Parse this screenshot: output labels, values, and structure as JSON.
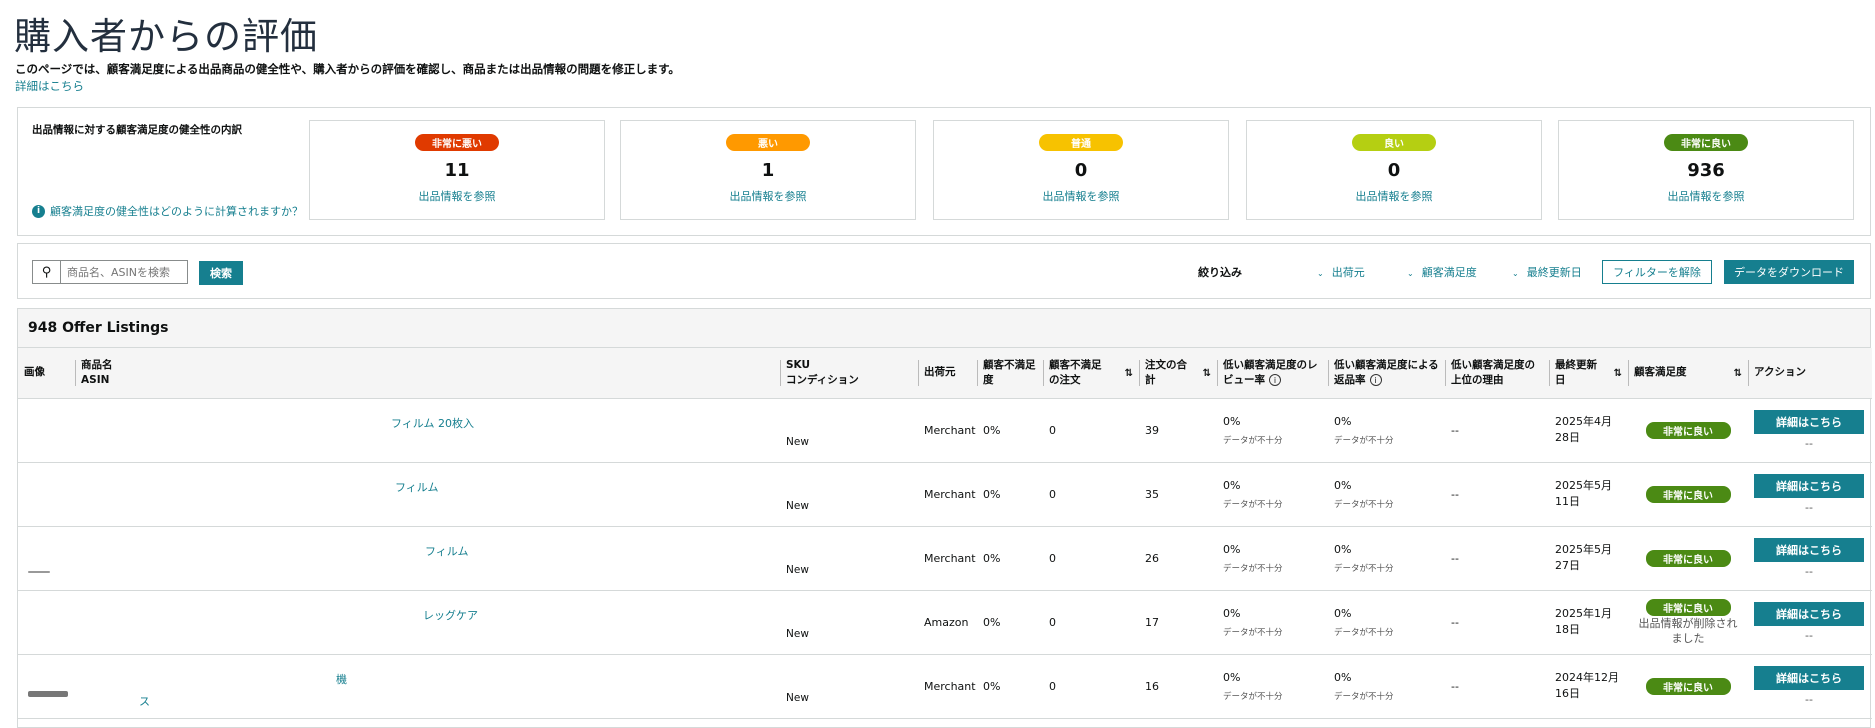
{
  "header": {
    "title": "購入者からの評価",
    "description": "このページでは、顧客満足度による出品商品の健全性や、購入者からの評価を確認し、商品または出品情報の問題を修正します。",
    "learn_more": "詳細はこちら"
  },
  "health": {
    "title": "出品情報に対する顧客満足度の健全性の内訳",
    "help_link": "顧客満足度の健全性はどのように計算されますか？",
    "cards": [
      {
        "label": "非常に悪い",
        "count": "11",
        "link": "出品情報を参照",
        "color": "#e03a00"
      },
      {
        "label": "悪い",
        "count": "1",
        "link": "出品情報を参照",
        "color": "#ff9900"
      },
      {
        "label": "普通",
        "count": "0",
        "link": "出品情報を参照",
        "color": "#f7c200"
      },
      {
        "label": "良い",
        "count": "0",
        "link": "出品情報を参照",
        "color": "#b5cf12"
      },
      {
        "label": "非常に良い",
        "count": "936",
        "link": "出品情報を参照",
        "color": "#4b8a14"
      }
    ]
  },
  "search": {
    "placeholder": "商品名、ASINを検索",
    "button": "検索"
  },
  "filters": {
    "label": "絞り込み",
    "items": [
      "出荷元",
      "顧客満足度",
      "最終更新日"
    ],
    "clear": "フィルターを解除",
    "download": "データをダウンロード"
  },
  "table": {
    "count_label": "948 Offer Listings",
    "headers": {
      "image": "画像",
      "name": "商品名",
      "asin": "ASIN",
      "sku": "SKU",
      "condition": "コンディション",
      "fulfilled": "出荷元",
      "dissat_rate": "顧客不満足度",
      "dissat_orders": "顧客不満足の注文",
      "total_orders": "注文の合計",
      "low_review": "低い顧客満足度のレビュー率",
      "low_return": "低い顧客満足度による返品率",
      "top_reason": "低い顧客満足度の上位の理由",
      "updated": "最終更新日",
      "satisfaction": "顧客満足度",
      "action": "アクション"
    },
    "rows": [
      {
        "name": "フィルム 20枚入",
        "name2": "",
        "condition": "New",
        "fulfilled": "Merchant",
        "dissat_rate": "0%",
        "dissat_orders": "0",
        "total_orders": "39",
        "review_rate": "0%",
        "review_note": "データが不十分",
        "return_rate": "0%",
        "return_note": "データが不十分",
        "reason": "--",
        "updated": "2025年4月28日",
        "satisfaction": "非常に良い",
        "note": "",
        "action": "詳細はこちら",
        "action_sub": "--"
      },
      {
        "name": "フィルム",
        "name2": "",
        "condition": "New",
        "fulfilled": "Merchant",
        "dissat_rate": "0%",
        "dissat_orders": "0",
        "total_orders": "35",
        "review_rate": "0%",
        "review_note": "データが不十分",
        "return_rate": "0%",
        "return_note": "データが不十分",
        "reason": "--",
        "updated": "2025年5月11日",
        "satisfaction": "非常に良い",
        "note": "",
        "action": "詳細はこちら",
        "action_sub": "--"
      },
      {
        "name": "フィルム",
        "name2": "",
        "condition": "New",
        "fulfilled": "Merchant",
        "dissat_rate": "0%",
        "dissat_orders": "0",
        "total_orders": "26",
        "review_rate": "0%",
        "review_note": "データが不十分",
        "return_rate": "0%",
        "return_note": "データが不十分",
        "reason": "--",
        "updated": "2025年5月27日",
        "satisfaction": "非常に良い",
        "note": "",
        "action": "詳細はこちら",
        "action_sub": "--"
      },
      {
        "name": "レッグケア",
        "name2": "",
        "condition": "New",
        "fulfilled": "Amazon",
        "dissat_rate": "0%",
        "dissat_orders": "0",
        "total_orders": "17",
        "review_rate": "0%",
        "review_note": "データが不十分",
        "return_rate": "0%",
        "return_note": "データが不十分",
        "reason": "--",
        "updated": "2025年1月18日",
        "satisfaction": "非常に良い",
        "note": "出品情報が削除されました",
        "action": "詳細はこちら",
        "action_sub": "--"
      },
      {
        "name": "機",
        "name2": "ス",
        "condition": "New",
        "fulfilled": "Merchant",
        "dissat_rate": "0%",
        "dissat_orders": "0",
        "total_orders": "16",
        "review_rate": "0%",
        "review_note": "データが不十分",
        "return_rate": "0%",
        "return_note": "データが不十分",
        "reason": "--",
        "updated": "2024年12月16日",
        "satisfaction": "非常に良い",
        "note": "",
        "action": "詳細はこちら",
        "action_sub": "--"
      }
    ]
  }
}
